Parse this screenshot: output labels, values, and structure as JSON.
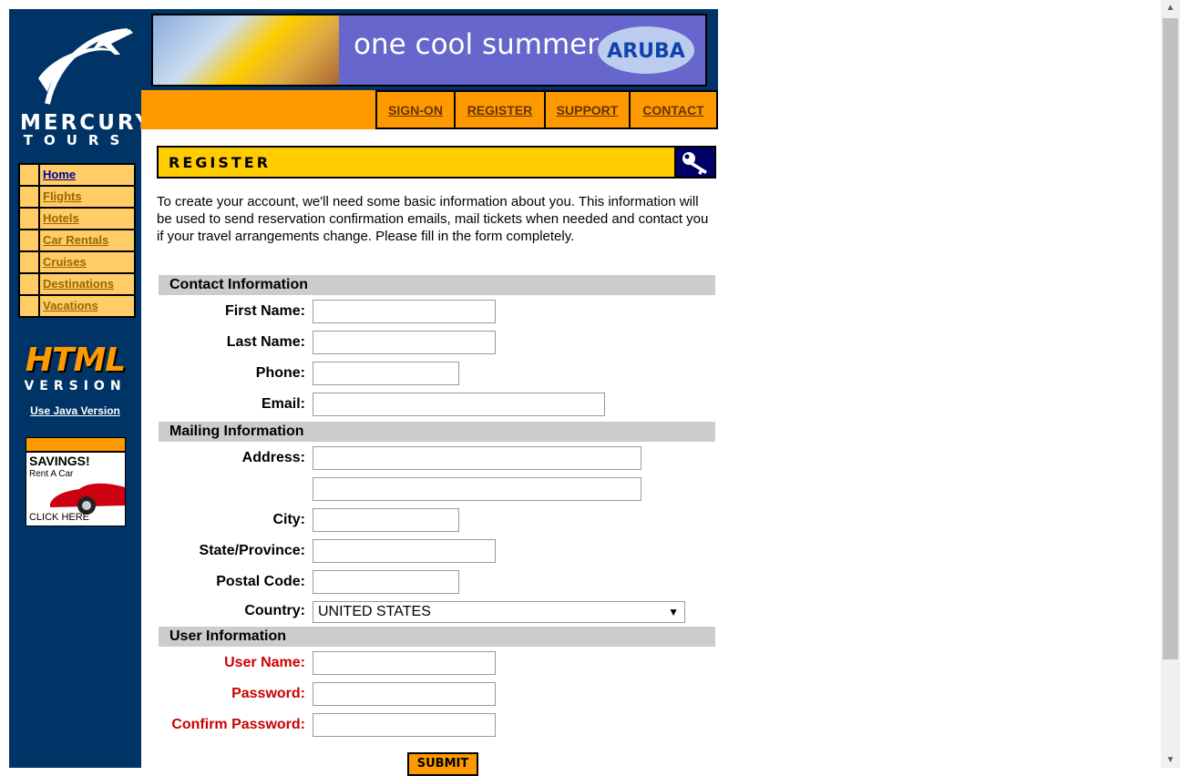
{
  "brand": {
    "name_line1": "MERCURY",
    "name_line2": "TOURS"
  },
  "banner": {
    "text": "one cool summer",
    "logo": "ARUBA"
  },
  "top_nav": [
    {
      "label": "SIGN-ON"
    },
    {
      "label": "REGISTER"
    },
    {
      "label": "SUPPORT"
    },
    {
      "label": "CONTACT"
    }
  ],
  "side_nav": [
    {
      "label": "Home"
    },
    {
      "label": "Flights"
    },
    {
      "label": "Hotels"
    },
    {
      "label": "Car Rentals"
    },
    {
      "label": "Cruises"
    },
    {
      "label": "Destinations"
    },
    {
      "label": "Vacations"
    }
  ],
  "version_badge": {
    "big": "HTML",
    "small": "VERSION",
    "java_link": "Use Java Version"
  },
  "ad": {
    "headline": "SAVINGS!",
    "sub": "Rent A Car",
    "cta": "CLICK HERE"
  },
  "page_header": "REGISTER",
  "intro": "To create your account, we'll need some basic information about you. This information will be used to send reservation confirmation emails, mail tickets when needed and contact you if your travel arrangements change. Please fill in the form completely.",
  "sections": {
    "contact": "Contact Information",
    "mailing": "Mailing Information",
    "user": "User Information"
  },
  "labels": {
    "first_name": "First Name:",
    "last_name": "Last Name:",
    "phone": "Phone:",
    "email": "Email:",
    "address": "Address:",
    "city": "City:",
    "state": "State/Province:",
    "postal": "Postal Code:",
    "country": "Country:",
    "username": "User Name:",
    "password": "Password:",
    "confirm_password": "Confirm Password:"
  },
  "country_value": "UNITED STATES",
  "submit_label": "SUBMIT",
  "colors": {
    "sidebar": "#003366",
    "accent_orange": "#ff9900",
    "header_yellow": "#ffcc00",
    "required_red": "#cc0000"
  }
}
